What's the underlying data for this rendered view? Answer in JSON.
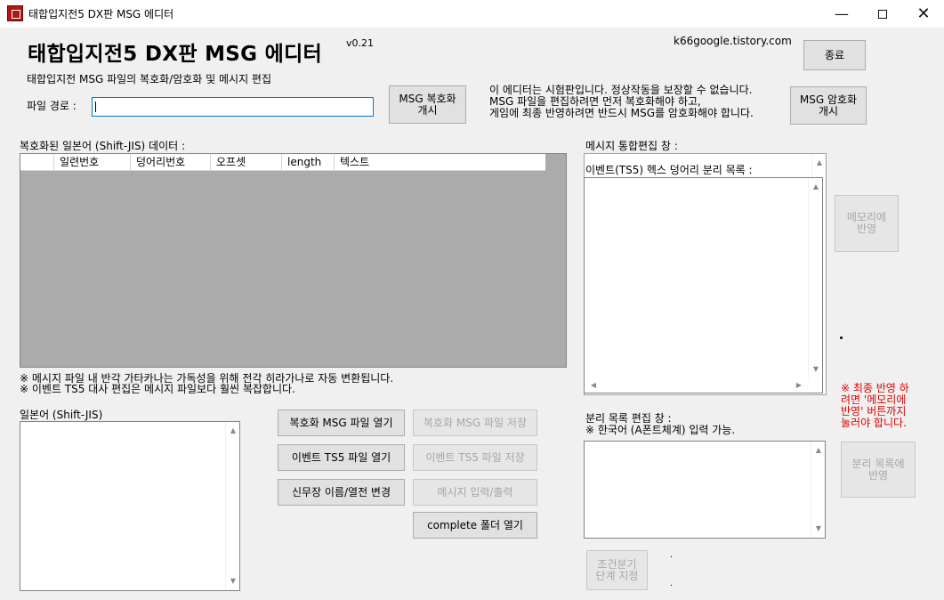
{
  "window": {
    "title": "태합입지전5 DX판 MSG 에디터",
    "minimize_icon": "minimize-icon",
    "maximize_icon": "maximize-icon",
    "close_icon": "close-icon"
  },
  "header": {
    "title": "태합입지전5 DX판 MSG 에디터",
    "version": "v0.21",
    "subtitle": "태합입지전 MSG 파일의 복호화/암호화 및 메시지 편집",
    "site": "k66google.tistory.com",
    "exit_label": "종료"
  },
  "file": {
    "path_label": "파일 경로 :",
    "path_value": ""
  },
  "buttons": {
    "decrypt_msg": "MSG 복호화\n개시",
    "encrypt_msg": "MSG 암호화\n개시",
    "apply_memory": "메모리에\n반영",
    "apply_split_list": "분리 목록에\n반영",
    "open_decrypted_msg": "복호화 MSG 파일 열기",
    "save_decrypted_msg": "복호화 MSG 파일 저장",
    "open_event_ts5": "이벤트 TS5 파일 열기",
    "save_event_ts5": "이벤트 TS5 파일 저장",
    "change_name": "신무장 이름/열전 변경",
    "message_io": "메시지 입력/출력",
    "open_complete_folder": "complete 폴더 열기",
    "branch_stage": "조건분기\n단계 지정"
  },
  "notice": {
    "line1": "이 에디터는 시험판입니다. 정상작동을 보장할 수 없습니다.",
    "line2": "MSG 파일을 편집하려면 먼저 복호화해야 하고,",
    "line3": "게임에 최종 반영하려면 반드시 MSG를 암호화해야 합니다."
  },
  "grid": {
    "label": "복호화된 일본어 (Shift-JIS) 데이터 :",
    "columns": [
      "",
      "일련번호",
      "덩어리번호",
      "오프셋",
      "length",
      "텍스트"
    ]
  },
  "notes": {
    "line1": "※ 메시지 파일 내 반각 가타카나는 가독성을 위해 전각 히라가나로 자동 변환됩니다.",
    "line2": "※ 이벤트 TS5 대사 편집은 메시지 파일보다 훨씬 복잡합니다."
  },
  "japanese": {
    "label": "일본어 (Shift-JIS)"
  },
  "integrated": {
    "label": "메시지 통합편집 창 :",
    "event_list_label": "이벤트(TS5) 헥스 덩어리 분리 목록 :"
  },
  "split_edit": {
    "label": "분리 목록 편집 창 :",
    "hint": "※ 한국어 (A폰트체계) 입력 가능."
  },
  "warning": {
    "text": "※ 최종 반영 하\n려면 '메모리에\n반영' 버튼까지\n눌러야 합니다."
  },
  "misc": {
    "dot": "."
  }
}
